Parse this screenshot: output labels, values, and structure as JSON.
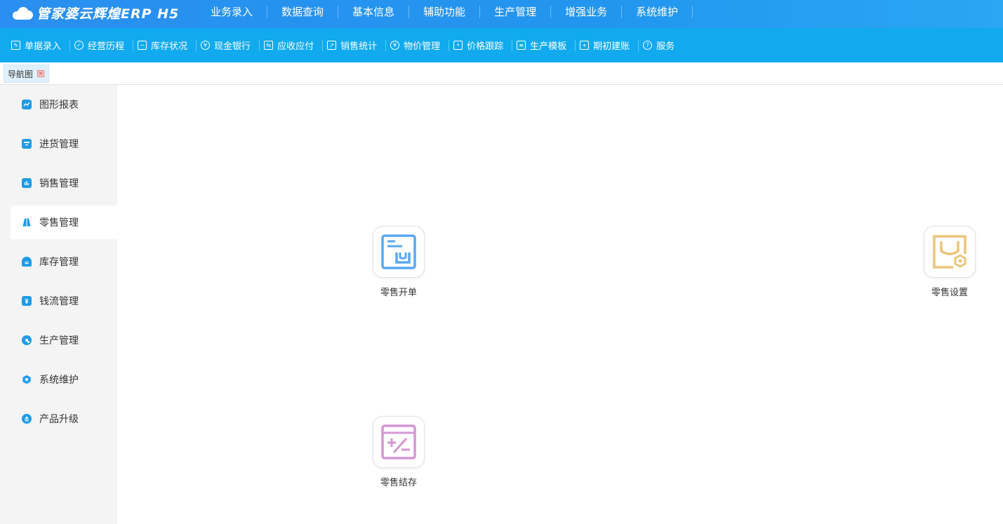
{
  "brand": {
    "title": "管家婆云辉煌ERP H5"
  },
  "top_nav": [
    {
      "label": "业务录入"
    },
    {
      "label": "数据查询"
    },
    {
      "label": "基本信息"
    },
    {
      "label": "辅助功能"
    },
    {
      "label": "生产管理"
    },
    {
      "label": "增强业务"
    },
    {
      "label": "系统维护"
    }
  ],
  "toolbar": [
    {
      "label": "单据录入",
      "icon": "document-edit-icon"
    },
    {
      "label": "经营历程",
      "icon": "check-circle-icon"
    },
    {
      "label": "库存状况",
      "icon": "inventory-box-icon"
    },
    {
      "label": "现金银行",
      "icon": "yuan-coin-icon"
    },
    {
      "label": "应收应付",
      "icon": "exchange-icon"
    },
    {
      "label": "销售统计",
      "icon": "chart-icon"
    },
    {
      "label": "物价管理",
      "icon": "price-icon"
    },
    {
      "label": "价格跟踪",
      "icon": "tracking-icon"
    },
    {
      "label": "生产模板",
      "icon": "template-icon"
    },
    {
      "label": "期初建账",
      "icon": "ledger-icon"
    },
    {
      "label": "服务",
      "icon": "help-circle-icon"
    }
  ],
  "tabs": [
    {
      "label": "导航图"
    }
  ],
  "sidebar": [
    {
      "label": "图形报表",
      "icon": "line-chart-icon"
    },
    {
      "label": "进货管理",
      "icon": "purchase-box-icon"
    },
    {
      "label": "销售管理",
      "icon": "bar-chart-icon"
    },
    {
      "label": "零售管理",
      "icon": "shopping-bag-icon"
    },
    {
      "label": "库存管理",
      "icon": "warehouse-icon"
    },
    {
      "label": "钱流管理",
      "icon": "money-icon"
    },
    {
      "label": "生产管理",
      "icon": "gear-icon"
    },
    {
      "label": "系统维护",
      "icon": "shield-icon"
    },
    {
      "label": "产品升级",
      "icon": "upgrade-icon"
    }
  ],
  "sidebar_active": "零售管理",
  "tiles": [
    {
      "label": "零售开单",
      "icon": "retail-order-icon",
      "color": "#5aa8f0"
    },
    {
      "label": "零售设置",
      "icon": "retail-settings-icon",
      "color": "#ecc47a"
    },
    {
      "label": "零售结存",
      "icon": "retail-balance-icon",
      "color": "#d596d6"
    }
  ],
  "colors": {
    "topbar": "#2296ef",
    "toolbar": "#11aaef",
    "sidebar_bg": "#f4f4f4",
    "sidebar_icon": "#1e9be6"
  }
}
